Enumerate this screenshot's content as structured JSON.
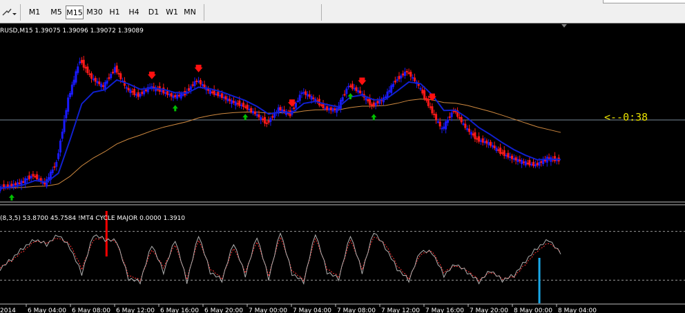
{
  "toolbar": {
    "timeframes": [
      "M1",
      "M5",
      "M15",
      "M30",
      "H1",
      "H4",
      "D1",
      "W1",
      "MN"
    ],
    "active_timeframe": "M15"
  },
  "chart_header": "RUSD,M15  1.39075 1.39096 1.39072 1.39089",
  "countdown": "<--0:38",
  "indicator_header": "(8,3,5) 53.8700 45.7584  !MT4 CYCLE MAJOR 0.0000 1.3910",
  "time_labels": [
    "2014",
    "6 May 04:00",
    "6 May 08:00",
    "6 May 12:00",
    "6 May 16:00",
    "6 May 20:00",
    "7 May 00:00",
    "7 May 04:00",
    "7 May 08:00",
    "7 May 12:00",
    "7 May 16:00",
    "7 May 20:00",
    "8 May 00:00",
    "8 May 04:00"
  ],
  "colors": {
    "bull": "#1a1aff",
    "bear": "#ff1a1a",
    "ma_fast": "#1020d0",
    "ma_slow": "#d08a40",
    "up_arrow": "#00c000",
    "down_arrow": "#ff1010",
    "countdown": "#e8e000",
    "stoch_main": "#b0b0b0",
    "stoch_signal": "#ff3030",
    "cycle_sell": "#ff0000",
    "cycle_buy": "#1aa8e8"
  },
  "chart_data": {
    "type": "line",
    "symbol_timeframe": "M15",
    "x": [
      "6 May 00:00",
      "6 May 02:00",
      "6 May 04:00",
      "6 May 06:00",
      "6 May 07:00",
      "6 May 08:00",
      "6 May 09:00",
      "6 May 10:00",
      "6 May 11:00",
      "6 May 12:00",
      "6 May 13:00",
      "6 May 14:00",
      "6 May 15:00",
      "6 May 16:00",
      "6 May 17:00",
      "6 May 18:00",
      "6 May 19:00",
      "6 May 20:00",
      "6 May 21:00",
      "6 May 22:00",
      "6 May 23:00",
      "7 May 00:00",
      "7 May 01:00",
      "7 May 02:00",
      "7 May 03:00",
      "7 May 04:00",
      "7 May 05:00",
      "7 May 06:00",
      "7 May 07:00",
      "7 May 08:00",
      "7 May 09:00",
      "7 May 10:00",
      "7 May 11:00",
      "7 May 12:00",
      "7 May 13:00",
      "7 May 14:00",
      "7 May 15:00",
      "7 May 16:00",
      "7 May 17:00",
      "7 May 18:00",
      "7 May 19:00",
      "7 May 20:00",
      "7 May 21:00",
      "7 May 22:00",
      "7 May 23:00",
      "8 May 00:00",
      "8 May 01:00",
      "8 May 02:00",
      "8 May 03:00"
    ],
    "series": [
      {
        "values": [
          10,
          14,
          22,
          36,
          18,
          62,
          190,
          268,
          232,
          214,
          252,
          210,
          196,
          214,
          206,
          194,
          200,
          228,
          206,
          196,
          184,
          176,
          160,
          140,
          170,
          158,
          204,
          190,
          170,
          168,
          218,
          202,
          176,
          190,
          226,
          246,
          216,
          170,
          128,
          168,
          132,
          108,
          100,
          82,
          70,
          62,
          56,
          70,
          66
        ]
      }
    ],
    "down_arrow_times": [
      "6 May 16:00",
      "6 May 20:00",
      "7 May 04:00",
      "7 May 10:00",
      "7 May 16:00"
    ],
    "up_arrow_times": [
      "6 May 02:00",
      "6 May 18:00",
      "7 May 00:00",
      "7 May 09:00",
      "7 May 11:00"
    ],
    "indicator": {
      "type": "line",
      "main": [
        34,
        46,
        60,
        70,
        64,
        76,
        60,
        28,
        76,
        70,
        68,
        22,
        18,
        64,
        30,
        70,
        18,
        76,
        30,
        20,
        66,
        26,
        74,
        22,
        80,
        28,
        18,
        78,
        30,
        22,
        76,
        30,
        80,
        60,
        34,
        20,
        56,
        54,
        26,
        40,
        30,
        18,
        32,
        20,
        26,
        44,
        60,
        70,
        52
      ],
      "signal": [
        36,
        44,
        56,
        68,
        66,
        72,
        64,
        34,
        70,
        72,
        66,
        26,
        20,
        58,
        36,
        64,
        22,
        70,
        34,
        22,
        60,
        30,
        68,
        26,
        74,
        32,
        20,
        72,
        34,
        24,
        70,
        34,
        74,
        64,
        38,
        22,
        52,
        56,
        30,
        38,
        32,
        20,
        30,
        22,
        24,
        40,
        56,
        66,
        54
      ],
      "levels": [
        80,
        20
      ],
      "sell_marker_time": "6 May 12:00",
      "buy_marker_time": "8 May 02:00"
    }
  }
}
